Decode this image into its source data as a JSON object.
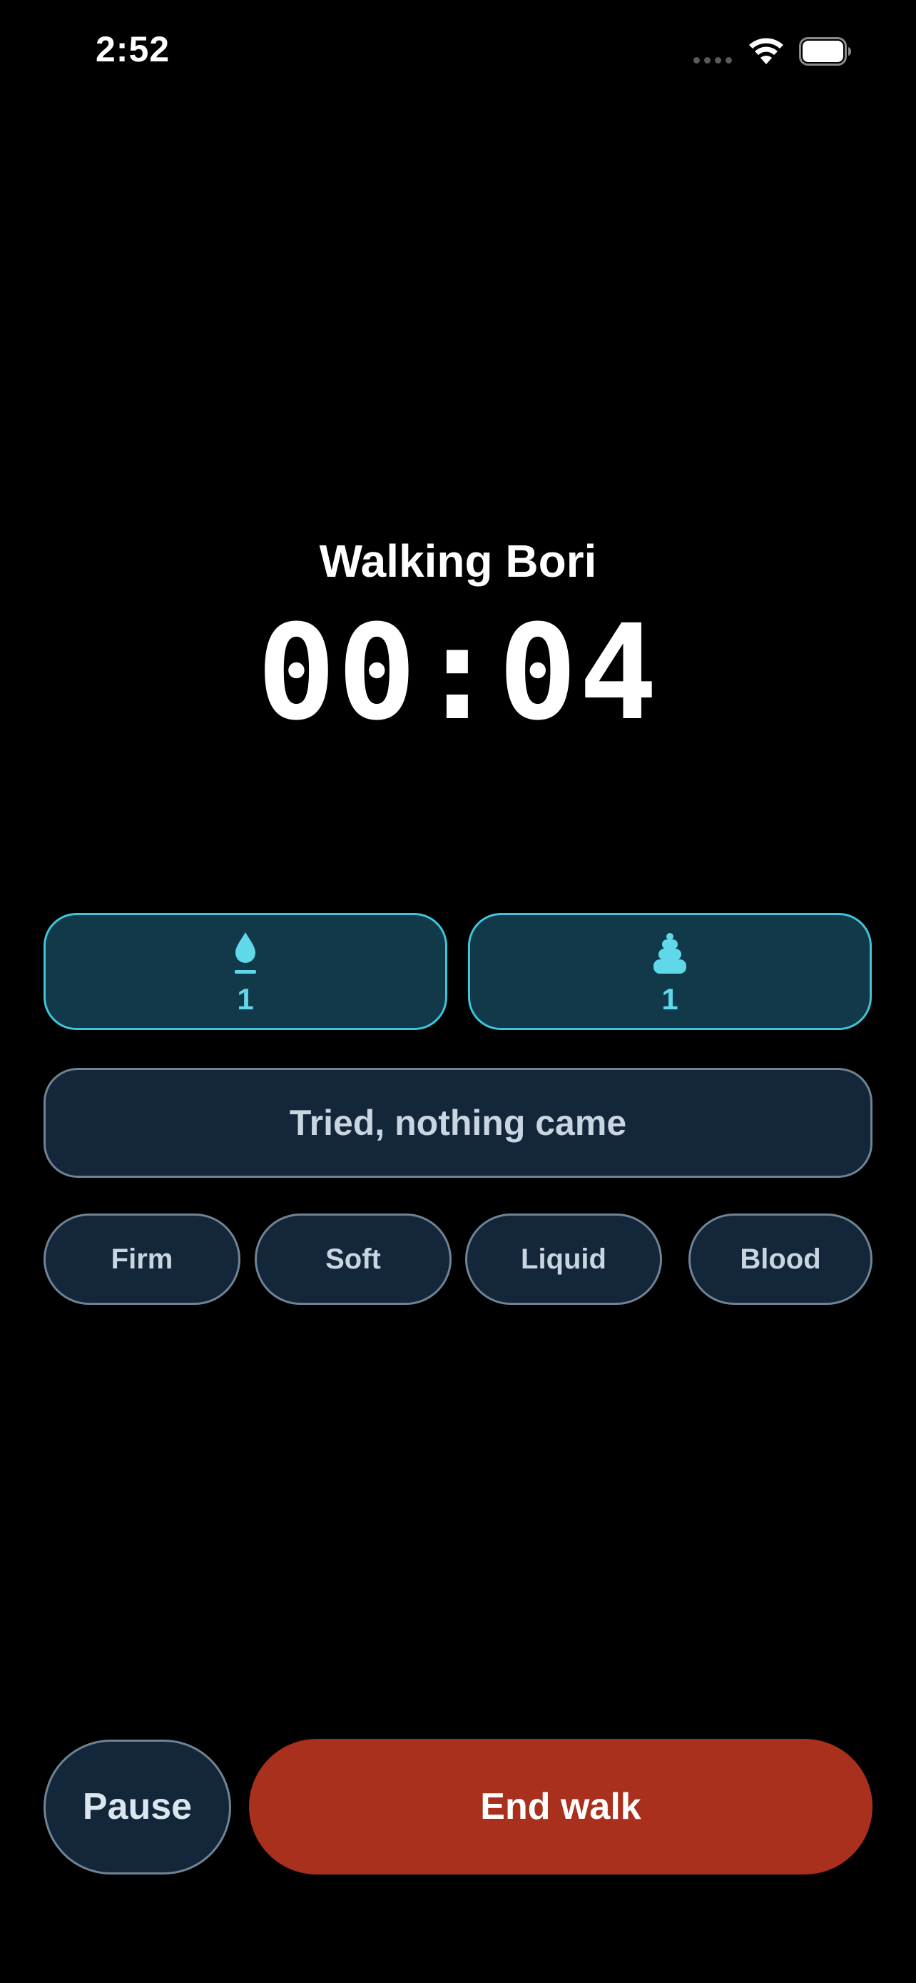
{
  "status_bar": {
    "time": "2:52",
    "icons": [
      "cellular-signal-icon",
      "wifi-icon",
      "battery-icon"
    ]
  },
  "walk": {
    "title": "Walking Bori",
    "timer": "00:04"
  },
  "counters": {
    "pee": {
      "icon": "droplet-icon",
      "count": "1"
    },
    "poop": {
      "icon": "poop-icon",
      "count": "1"
    }
  },
  "actions": {
    "tried_label": "Tried, nothing came"
  },
  "consistency": {
    "options": [
      "Firm",
      "Soft",
      "Liquid",
      "Blood"
    ]
  },
  "controls": {
    "pause_label": "Pause",
    "end_label": "End walk"
  },
  "colors": {
    "background": "#000000",
    "accent_cyan": "#3ec6d8",
    "counter_fill": "#12394a",
    "button_fill": "#13263a",
    "end_button": "#a8301c"
  }
}
